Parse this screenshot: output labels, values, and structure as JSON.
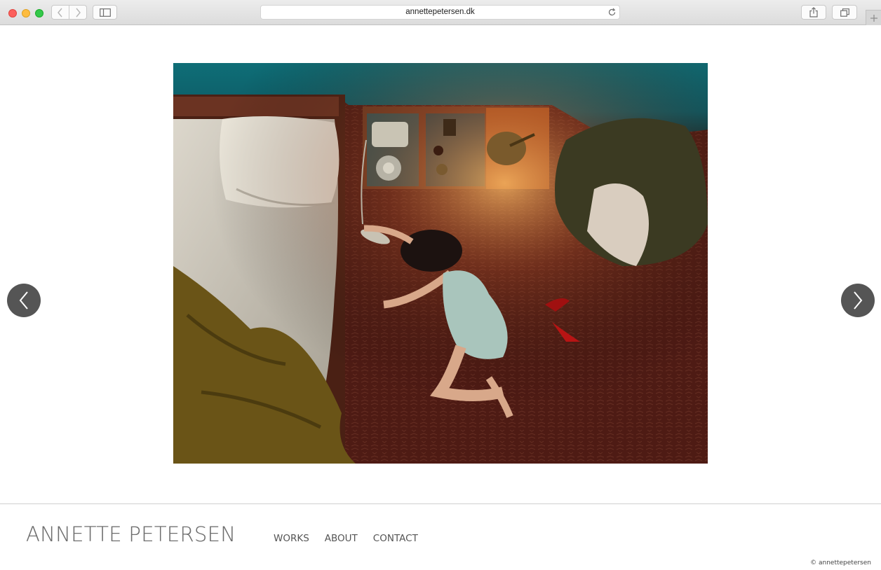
{
  "browser": {
    "url": "annettepetersen.dk",
    "icons": {
      "back": "chevron-left-icon",
      "forward": "chevron-right-icon",
      "sidebar": "sidebar-icon",
      "reload": "reload-icon",
      "share": "share-icon",
      "tabs": "tabs-overview-icon",
      "new_tab": "plus-icon"
    }
  },
  "slideshow": {
    "prev_icon": "chevron-left-icon",
    "next_icon": "chevron-right-icon",
    "image_subject": "artwork-photo"
  },
  "footer": {
    "site_title": "ANNETTE PETERSEN",
    "menu": [
      {
        "label": "WORKS"
      },
      {
        "label": "ABOUT"
      },
      {
        "label": "CONTACT"
      }
    ],
    "copyright": "© annettepetersen"
  },
  "colors": {
    "arrow_bg": "#555555",
    "footer_text": "#6d6d6d",
    "divider": "#cfcfcf"
  }
}
